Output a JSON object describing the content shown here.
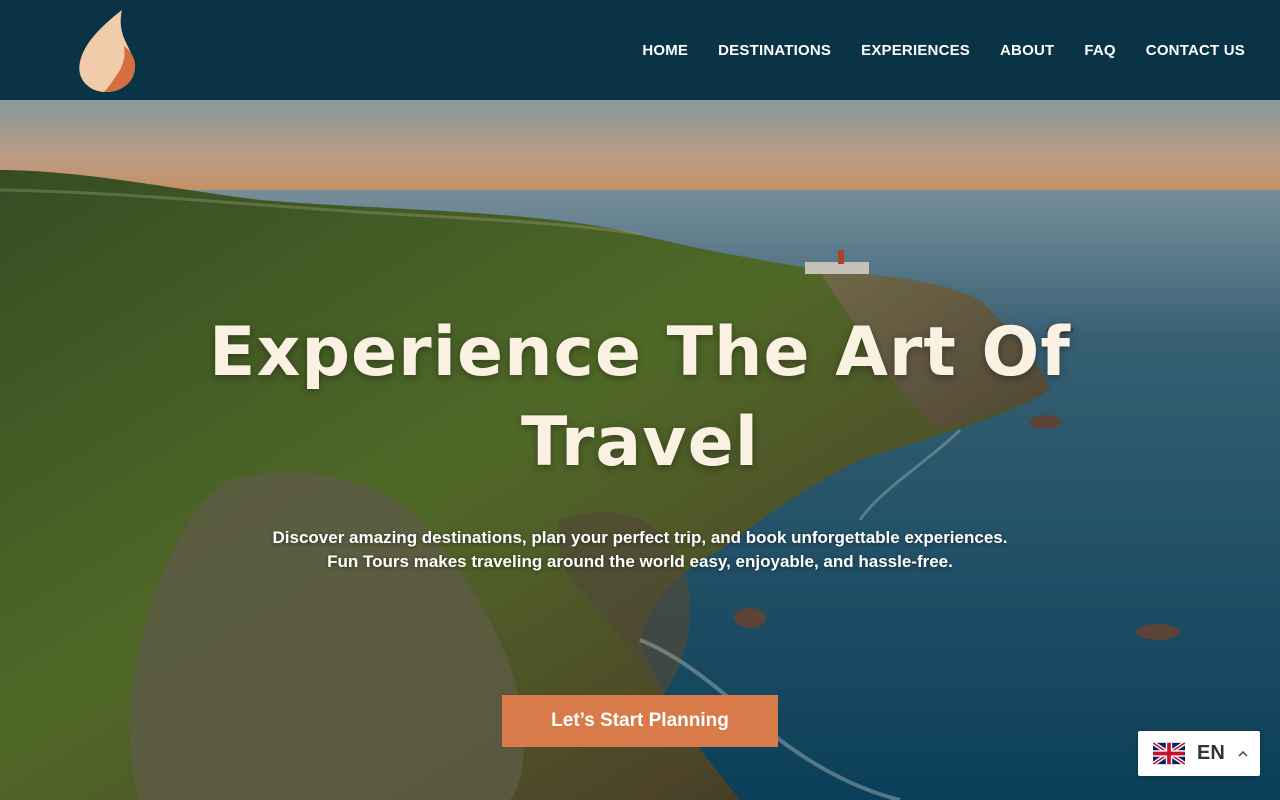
{
  "header": {
    "nav": [
      {
        "label": "HOME"
      },
      {
        "label": "DESTINATIONS"
      },
      {
        "label": "EXPERIENCES"
      },
      {
        "label": "ABOUT"
      },
      {
        "label": "FAQ"
      },
      {
        "label": "CONTACT US"
      }
    ]
  },
  "hero": {
    "title_line1": "Experience The Art Of",
    "title_line2": "Travel",
    "subtitle_line1": "Discover amazing destinations, plan your perfect trip, and book unforgettable experiences.",
    "subtitle_line2": "Fun Tours makes traveling around the world easy, enjoyable, and hassle-free.",
    "cta_label": "Let’s Start Planning"
  },
  "language": {
    "code": "EN",
    "flag_icon": "uk-flag-icon",
    "chevron_icon": "chevron-up-icon"
  },
  "colors": {
    "header_bg": "#0a3345",
    "accent": "#d97a4a",
    "title_text": "#fbf1e2"
  }
}
